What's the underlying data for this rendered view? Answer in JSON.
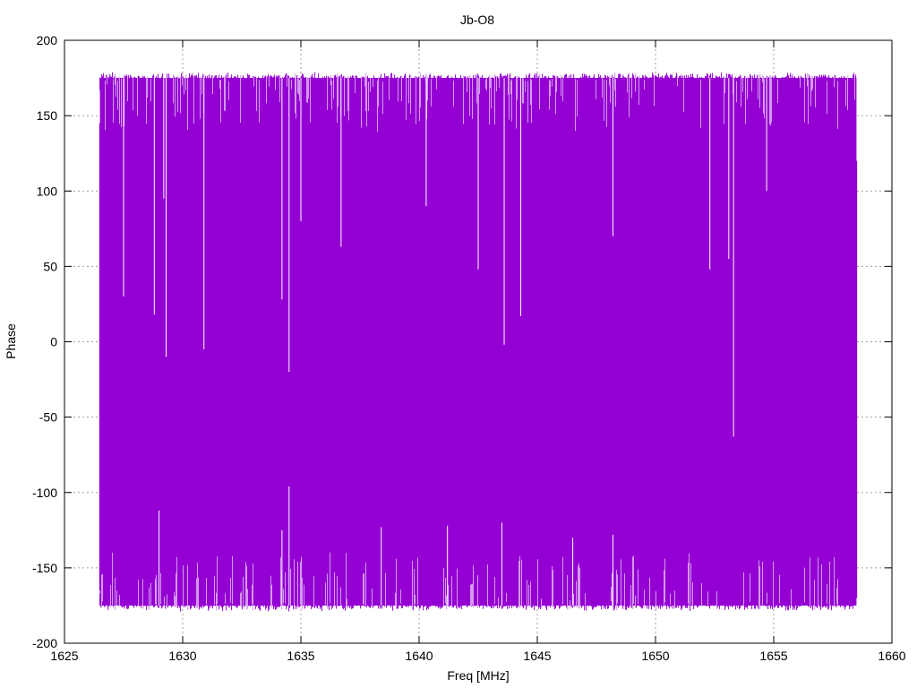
{
  "chart_data": {
    "type": "line",
    "title": "Jb-O8",
    "xlabel": "Freq [MHz]",
    "ylabel": "Phase",
    "xlim": [
      1625,
      1660
    ],
    "ylim": [
      -200,
      200
    ],
    "x_ticks": [
      1625,
      1630,
      1635,
      1640,
      1645,
      1650,
      1655,
      1660
    ],
    "y_ticks": [
      -200,
      -150,
      -100,
      -50,
      0,
      50,
      100,
      150,
      200
    ],
    "grid": true,
    "series": [
      {
        "color": "#9400d3",
        "x_range": [
          1626.5,
          1658.5
        ],
        "typical_max": 175,
        "typical_min": -175,
        "upper_dips": [
          {
            "x": 1627.5,
            "y": 30
          },
          {
            "x": 1628.8,
            "y": 18
          },
          {
            "x": 1629.2,
            "y": 95
          },
          {
            "x": 1629.3,
            "y": -10
          },
          {
            "x": 1630.9,
            "y": -5
          },
          {
            "x": 1634.2,
            "y": 28
          },
          {
            "x": 1634.5,
            "y": -20
          },
          {
            "x": 1635.0,
            "y": 80
          },
          {
            "x": 1636.7,
            "y": 63
          },
          {
            "x": 1640.3,
            "y": 90
          },
          {
            "x": 1642.5,
            "y": 48
          },
          {
            "x": 1643.6,
            "y": -2
          },
          {
            "x": 1644.3,
            "y": 17
          },
          {
            "x": 1648.2,
            "y": 70
          },
          {
            "x": 1652.3,
            "y": 48
          },
          {
            "x": 1653.1,
            "y": 55
          },
          {
            "x": 1653.3,
            "y": -63
          },
          {
            "x": 1654.7,
            "y": 100
          }
        ],
        "lower_spikes": [
          {
            "x": 1629.0,
            "y": -112
          },
          {
            "x": 1634.5,
            "y": -96
          },
          {
            "x": 1634.2,
            "y": -125
          },
          {
            "x": 1638.4,
            "y": -123
          },
          {
            "x": 1641.2,
            "y": -122
          },
          {
            "x": 1643.5,
            "y": -120
          },
          {
            "x": 1648.2,
            "y": -128
          },
          {
            "x": 1646.5,
            "y": -130
          }
        ]
      }
    ]
  }
}
